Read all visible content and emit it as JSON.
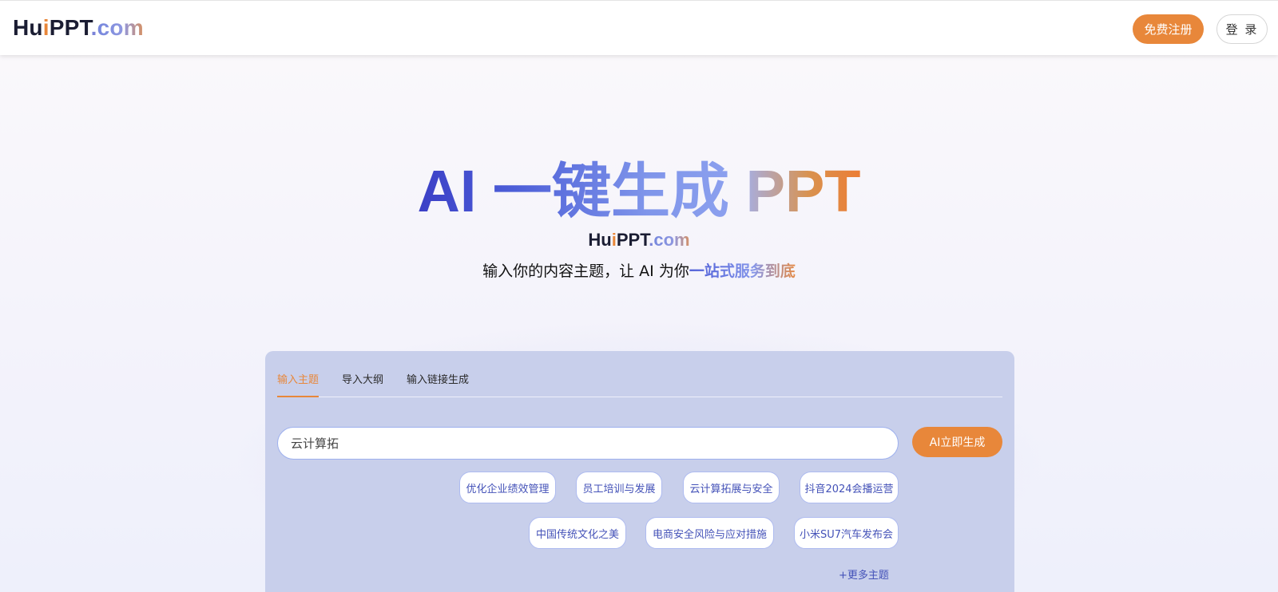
{
  "header": {
    "logo": {
      "hu": "Hu",
      "i": "i",
      "ppt": "PPT",
      "dot": ".",
      "com": "com"
    },
    "register_label": "免费注册",
    "login_label": "登 录"
  },
  "hero": {
    "title_main": "AI 一键生成 ",
    "title_ppt": "PPT",
    "logo": {
      "hu": "Hu",
      "i": "i",
      "ppt": "PPT",
      "dot": ".",
      "com": "com"
    },
    "subtitle_prefix": "输入你的内容主题，让 AI 为你",
    "subtitle_highlight": "一站式服务到底"
  },
  "panel": {
    "tabs": [
      {
        "label": "输入主题",
        "active": true
      },
      {
        "label": "导入大纲",
        "active": false
      },
      {
        "label": "输入链接生成",
        "active": false
      }
    ],
    "search": {
      "value": "云计算拓",
      "placeholder": ""
    },
    "generate_label": "AI立即生成",
    "topic_chips": [
      "优化企业绩效管理",
      "员工培训与发展",
      "云计算拓展与安全",
      "抖音2024会播运营",
      "中国传统文化之美",
      "电商安全风险与应对措施",
      "小米SU7汽车发布会"
    ],
    "more_label": "+更多主题"
  },
  "colors": {
    "accent_orange": "#e8873a",
    "brand_indigo": "#3b3fc6",
    "panel_bg": "#c8cfeb",
    "chip_text": "#4452b8"
  }
}
